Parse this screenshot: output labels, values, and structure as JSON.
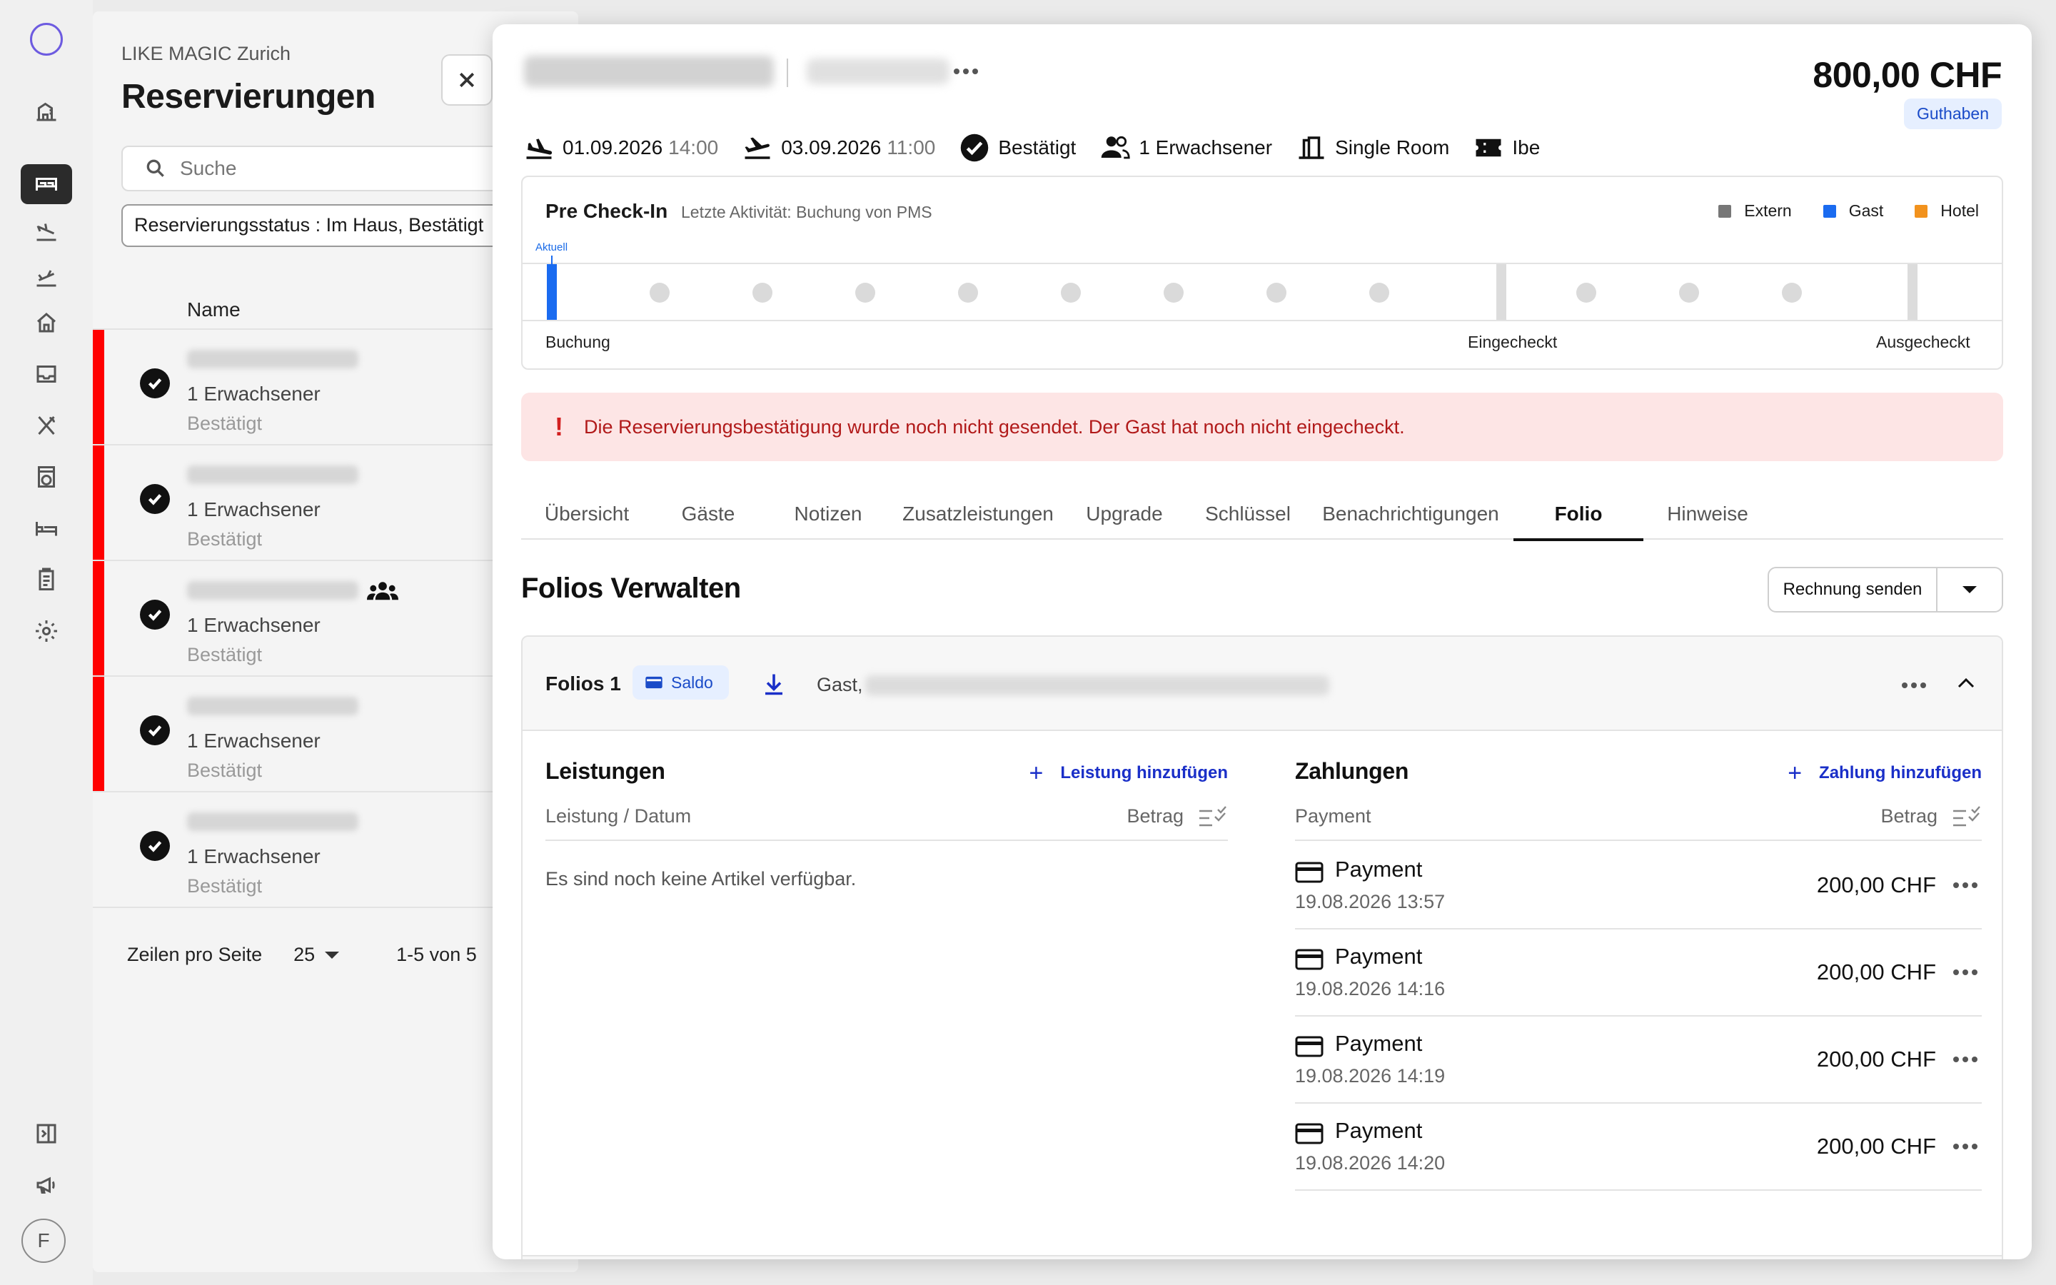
{
  "list": {
    "org": "LIKE MAGIC Zurich",
    "title": "Reservierungen",
    "search_placeholder": "Suche",
    "filter": "Reservierungsstatus : Im Haus, Bestätigt",
    "column_name": "Name",
    "rows": [
      {
        "adults": "1 Erwachsener",
        "status": "Bestätigt",
        "flag": true,
        "group": false
      },
      {
        "adults": "1 Erwachsener",
        "status": "Bestätigt",
        "flag": true,
        "group": false
      },
      {
        "adults": "1 Erwachsener",
        "status": "Bestätigt",
        "flag": true,
        "group": true
      },
      {
        "adults": "1 Erwachsener",
        "status": "Bestätigt",
        "flag": true,
        "group": false
      },
      {
        "adults": "1 Erwachsener",
        "status": "Bestätigt",
        "flag": false,
        "group": false
      }
    ],
    "rows_per_page_label": "Zeilen pro Seite",
    "rows_per_page": "25",
    "range": "1-5 von 5"
  },
  "rail": {
    "avatar": "F",
    "icons": [
      "logo-icon",
      "building-icon",
      "bed-icon",
      "arrival-icon",
      "departure-icon",
      "home-icon",
      "inbox-icon",
      "dining-icon",
      "laundry-icon",
      "rooms-icon",
      "clipboard-icon",
      "settings-icon",
      "collapse-icon",
      "megaphone-icon"
    ]
  },
  "detail": {
    "amount": "800,00 CHF",
    "balance_badge": "Guthaben",
    "arrival_date": "01.09.2026",
    "arrival_time": "14:00",
    "departure_date": "03.09.2026",
    "departure_time": "11:00",
    "status": "Bestätigt",
    "guests": "1 Erwachsener",
    "room": "Single Room",
    "channel": "Ibe",
    "precheckin": {
      "title": "Pre Check-In",
      "last_activity": "Letzte Aktivität: Buchung von PMS",
      "legend": [
        {
          "label": "Extern",
          "color": "#777777"
        },
        {
          "label": "Gast",
          "color": "#1a6bf0"
        },
        {
          "label": "Hotel",
          "color": "#f2921d"
        }
      ],
      "current_label": "Aktuell",
      "stage_booking": "Buchung",
      "stage_checkedin": "Eingecheckt",
      "stage_checkedout": "Ausgecheckt"
    },
    "alert": "Die Reservierungsbestätigung wurde noch nicht gesendet. Der Gast hat noch nicht eingecheckt.",
    "tabs": [
      "Übersicht",
      "Gäste",
      "Notizen",
      "Zusatzleistungen",
      "Upgrade",
      "Schlüssel",
      "Benachrichtigungen",
      "Folio",
      "Hinweise"
    ],
    "active_tab": "Folio",
    "folios_title": "Folios Verwalten",
    "send_invoice": "Rechnung senden",
    "folio": {
      "name": "Folios 1",
      "badge": "Saldo",
      "guest_prefix": "Gast,",
      "services": {
        "title": "Leistungen",
        "add": "Leistung hinzufügen",
        "col_left": "Leistung / Datum",
        "col_right": "Betrag",
        "empty": "Es sind noch keine Artikel verfügbar."
      },
      "payments": {
        "title": "Zahlungen",
        "add": "Zahlung hinzufügen",
        "col_left": "Payment",
        "col_right": "Betrag",
        "items": [
          {
            "name": "Payment",
            "date": "19.08.2026 13:57",
            "amount": "200,00 CHF"
          },
          {
            "name": "Payment",
            "date": "19.08.2026 14:16",
            "amount": "200,00 CHF"
          },
          {
            "name": "Payment",
            "date": "19.08.2026 14:19",
            "amount": "200,00 CHF"
          },
          {
            "name": "Payment",
            "date": "19.08.2026 14:20",
            "amount": "200,00 CHF"
          }
        ]
      }
    }
  }
}
